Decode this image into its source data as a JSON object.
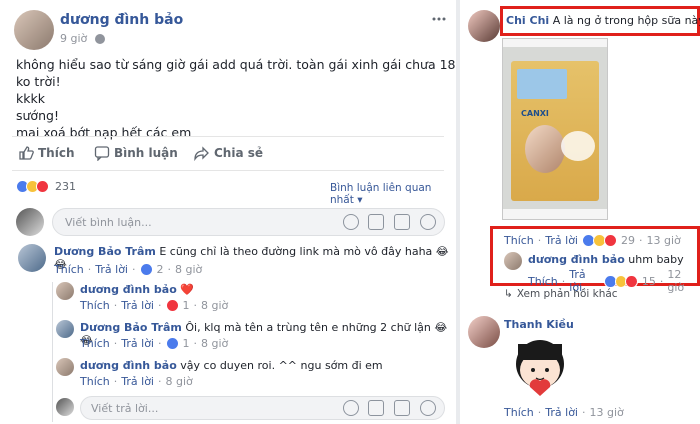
{
  "post": {
    "author": "dương đình bảo",
    "time": "9 giờ",
    "lines": [
      "không hiểu sao từ sáng giờ gái add quá trời. toàn gái xinh gái chưa 18 ko trời!",
      "kkkk",
      "sướng!",
      "mai xoá bớt nạp hết các em"
    ],
    "actions": {
      "like": "Thích",
      "comment": "Bình luận",
      "share": "Chia sẻ"
    },
    "reaction_count": "231",
    "sort_label": "Bình luận liên quan nhất",
    "comment_placeholder": "Viết bình luận..."
  },
  "comments": [
    {
      "author": "Dương Bảo Trâm",
      "text": "E cũng chỉ là theo đường link mà mò vô đây haha 😂😂",
      "like": "Thích",
      "reply": "Trả lời",
      "count": "2",
      "time": "8 giờ"
    }
  ],
  "replies": [
    {
      "author": "dương đình bảo",
      "text": "❤️",
      "like": "Thích",
      "reply": "Trả lời",
      "count": "1",
      "time": "8 giờ"
    },
    {
      "author": "Dương Bảo Trâm",
      "text": "Ôi, klq mà tên a trùng tên e những 2 chữ lận 😂😂",
      "like": "Thích",
      "reply": "Trả lời",
      "count": "1",
      "time": "8 giờ"
    },
    {
      "author": "dương đình bảo",
      "text": "vậy co duyen roi. ^^ ngu sớm đi em",
      "like": "Thích",
      "reply": "Trả lời",
      "count": "",
      "time": "8 giờ"
    }
  ],
  "reply_placeholder": "Viết trả lời...",
  "right": {
    "comment1": {
      "author": "Chi Chi",
      "text": "A là ng ở trong hộp sữa này ạ 😊",
      "like": "Thích",
      "reply": "Trả lời",
      "count": "29",
      "time": "13 giờ"
    },
    "reply1": {
      "author": "dương đình bảo",
      "text": "uhm baby",
      "like": "Thích",
      "reply": "Trả lời",
      "count": "15",
      "time": "12 giờ"
    },
    "more_replies": "Xem phản hồi khác",
    "comment2": {
      "author": "Thanh Kiều",
      "like": "Thích",
      "reply": "Trả lời",
      "time": "13 giờ"
    },
    "carton_label": "CANXI"
  }
}
